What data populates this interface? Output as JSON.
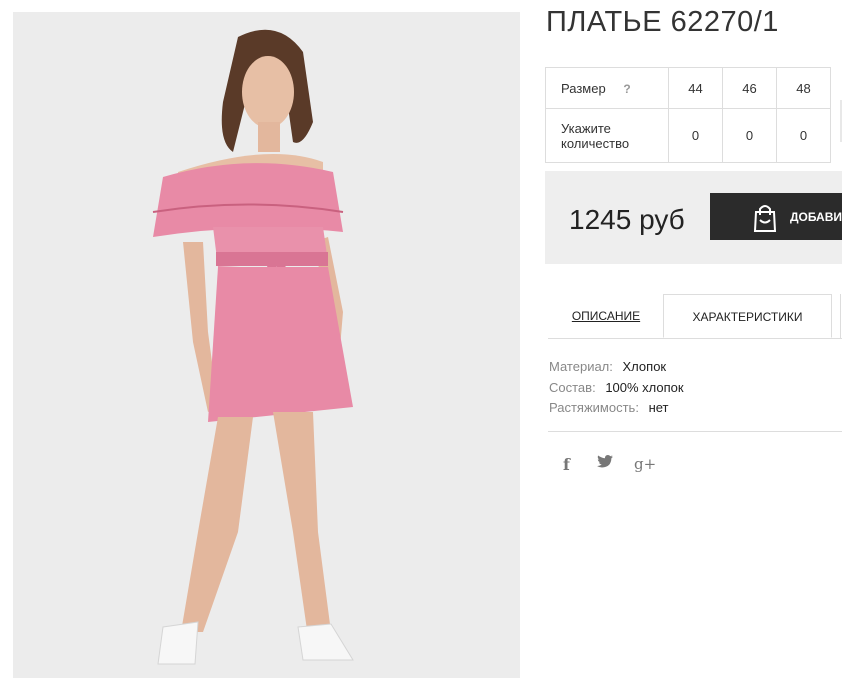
{
  "product": {
    "title": "ПЛАТЬЕ 62270/1",
    "price": "1245 руб",
    "add_to_cart_label": "ДОБАВИТЬ"
  },
  "sizes": {
    "size_label": "Размер",
    "help_icon": "?",
    "quantity_label": "Укажите количество",
    "items": [
      {
        "size": "44",
        "qty": "0"
      },
      {
        "size": "46",
        "qty": "0"
      },
      {
        "size": "48",
        "qty": "0"
      }
    ]
  },
  "tabs": [
    {
      "label": "ОПИСАНИЕ",
      "active": false
    },
    {
      "label": "ХАРАКТЕРИСТИКИ",
      "active": true
    }
  ],
  "specs": [
    {
      "key": "Материал:",
      "value": "Хлопок"
    },
    {
      "key": "Состав:",
      "value": "100% хлопок"
    },
    {
      "key": "Растяжимость:",
      "value": "нет"
    }
  ],
  "social": {
    "facebook": "f",
    "twitter": "twitter-icon",
    "google_plus": "g+"
  },
  "colors": {
    "button_bg": "#2b2b2b",
    "price_box_bg": "#eeeeee",
    "dress": "#e88aa6"
  }
}
